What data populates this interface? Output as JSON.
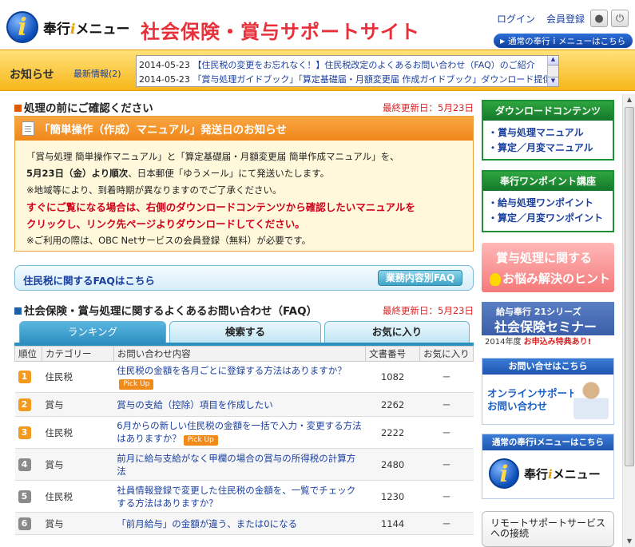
{
  "header": {
    "logo_text": "奉行",
    "logo_i": "i",
    "logo_suffix": "メニュー",
    "site_title": "社会保険・賞与サポートサイト",
    "login": "ログイン",
    "register": "会員登録",
    "normal_menu_button": "通常の奉行ｉメニューはこちら"
  },
  "notice": {
    "title": "お知らせ",
    "latest": "最新情報(2)",
    "items": [
      {
        "date": "2014-05-23",
        "text": "【住民税の変更をお忘れなく！】住民税改定のよくあるお問い合わせ（FAQ）のご紹介"
      },
      {
        "date": "2014-05-23",
        "text": "「賞与処理ガイドブック」「算定基礎届・月額変更届 作成ガイドブック」ダウンロード提供の"
      }
    ]
  },
  "confirm_section": {
    "title": "処理の前にご確認ください",
    "updated": "最終更新日：5月23日"
  },
  "info_box": {
    "title": "「簡単操作（作成）マニュアル」発送日のお知らせ",
    "line1": "「賞与処理 簡単操作マニュアル」と「算定基礎届・月額変更届 簡単作成マニュアル」を、",
    "line2_bold": "5月23日（金）より順次",
    "line2_rest": "、日本郵便「ゆうメール」にて発送いたします。",
    "line3": "※地域等により、到着時期が異なりますのでご了承ください。",
    "red1": "すぐにご覧になる場合は、右側のダウンロードコンテンツから確認したいマニュアルを",
    "red2": "クリックし、リンク先ページよりダウンロードしてください。",
    "line4": "※ご利用の際は、OBC Netサービスの会員登録（無料）が必要です。"
  },
  "faq_bar": {
    "label": "住民税に関するFAQはこちら",
    "button": "業務内容別FAQ"
  },
  "faq_section": {
    "title": "社会保険・賞与処理に関するよくあるお問い合わせ（FAQ）",
    "updated": "最終更新日：5月23日",
    "tabs": [
      "ランキング",
      "検索する",
      "お気に入り"
    ],
    "columns": [
      "順位",
      "カテゴリー",
      "お問い合わせ内容",
      "文書番号",
      "お気に入り"
    ],
    "pickup_label": "Pick Up",
    "rows": [
      {
        "rank": "1",
        "category": "住民税",
        "question": "住民税の金額を各月ごとに登録する方法はありますか？",
        "pickup": true,
        "doc": "1082",
        "fav": "－"
      },
      {
        "rank": "2",
        "category": "賞与",
        "question": "賞与の支給（控除）項目を作成したい",
        "pickup": false,
        "doc": "2262",
        "fav": "－"
      },
      {
        "rank": "3",
        "category": "住民税",
        "question": "6月からの新しい住民税の金額を一括で入力・変更する方法はありますか？",
        "pickup": true,
        "doc": "2222",
        "fav": "－"
      },
      {
        "rank": "4",
        "category": "賞与",
        "question": "前月に給与支給がなく甲欄の場合の賞与の所得税の計算方法",
        "pickup": false,
        "doc": "2480",
        "fav": "－"
      },
      {
        "rank": "5",
        "category": "住民税",
        "question": "社員情報登録で変更した住民税の金額を、一覧でチェックする方法はありますか？",
        "pickup": false,
        "doc": "1230",
        "fav": "－"
      },
      {
        "rank": "6",
        "category": "賞与",
        "question": "「前月給与」の金額が違う、または0になる",
        "pickup": false,
        "doc": "1144",
        "fav": "－"
      }
    ]
  },
  "sidebar": {
    "download": {
      "title": "ダウンロードコンテンツ",
      "items": [
        "・賞与処理マニュアル",
        "・算定／月変マニュアル"
      ]
    },
    "onepoint": {
      "title": "奉行ワンポイント講座",
      "items": [
        "・給与処理ワンポイント",
        "・算定／月変ワンポイント"
      ]
    },
    "bonus_banner": {
      "line1": "賞与処理に関する",
      "line2": "お悩み解決のヒント"
    },
    "seminar_banner": {
      "line1": "給与奉行 21シリーズ",
      "line2": "社会保険セミナー",
      "line3a": "2014年度 ",
      "line3b": "お申込み特典あり!"
    },
    "online_banner": {
      "header": "お問い合せはこちら",
      "line1": "オンラインサポート",
      "line2": "お問い合わせ"
    },
    "menu_banner": {
      "header": "通常の奉行iメニューはこちら",
      "logo_text": "奉行",
      "logo_i": "i",
      "logo_suffix": "メニュー"
    },
    "remote_banner": {
      "line1": "リモートサポートサービス",
      "line2": "への接続"
    }
  }
}
